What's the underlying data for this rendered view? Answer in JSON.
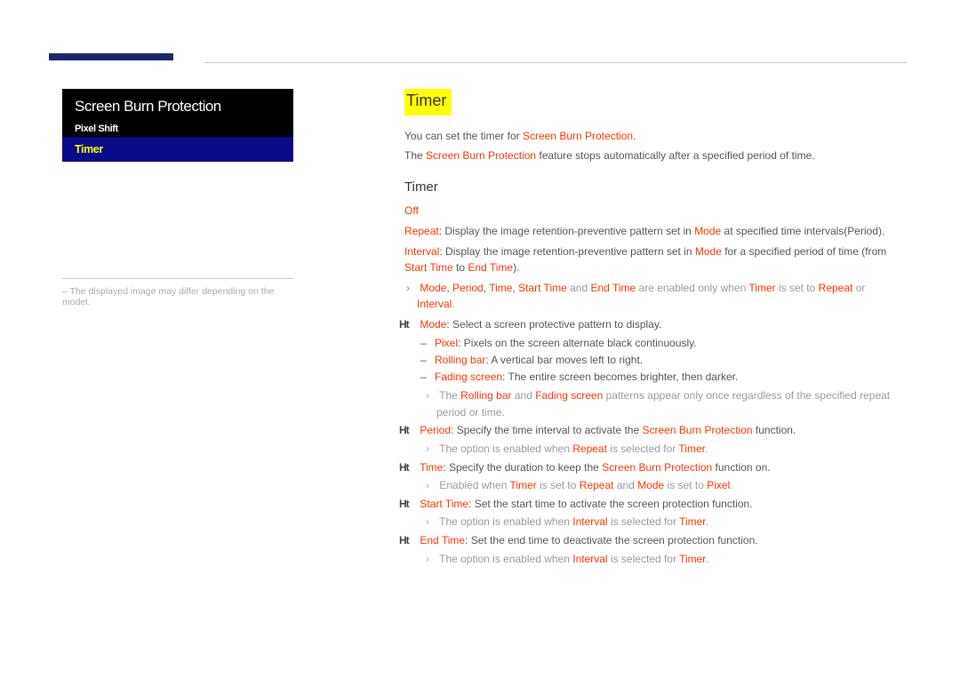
{
  "left": {
    "panel_title": "Screen Burn Protection",
    "row_pixel": "Pixel Shift",
    "row_timer": "Timer",
    "disclaimer": "The displayed image may differ depending on the model."
  },
  "right": {
    "section": "Timer",
    "intro1a": "You can set the timer for ",
    "intro1b": "Screen Burn Protection",
    "intro1c": ".",
    "intro2a": "The ",
    "intro2b": "Screen Burn Protection",
    "intro2c": " feature stops automatically after a specified period of time.",
    "sub": "Timer",
    "off": "Off",
    "repeat_lbl": "Repeat",
    "repeat_txt1": ": Display the image retention-preventive pattern set in ",
    "repeat_txt2": " at specified time intervals(Period).",
    "interval_lbl": "Interval",
    "interval_txt1": ": Display the image retention-preventive pattern set in ",
    "interval_txt2": " for a specified period of time (from ",
    "interval_txt3": " to ",
    "interval_txt4": ").",
    "mode_w": "Mode",
    "period_w": "Period",
    "time_w": "Time",
    "start_w": "Start Time",
    "end_w": "End Time",
    "enabled_txt1": " are enabled only when ",
    "enabled_txt2": " is set to ",
    "enabled_txt3": " or ",
    "enabled_txt4": ".",
    "and": " and ",
    "comma": ", ",
    "timer_w": "Timer",
    "repeat_w": "Repeat",
    "interval_w": "Interval",
    "mode_desc": ": Select a screen protective pattern to display.",
    "pixel_w": "Pixel",
    "pixel_desc": ": Pixels on the screen alternate black continuously.",
    "rolling_w": "Rolling bar",
    "rolling_desc": ": A vertical bar moves left to right.",
    "fading_w": "Fading screen",
    "fading_desc": ": The entire screen becomes brighter, then darker.",
    "rb_note1": "The ",
    "rb_note2": " and ",
    "rb_note3": " patterns appear only once regardless of the specified repeat period or time.",
    "period_desc1": ": Specify the time interval to activate the ",
    "sbp": "Screen Burn Protection",
    "period_desc2": " function.",
    "period_note1": "The option is enabled when ",
    "period_note2": " is selected for ",
    "time_desc1": ": Specify the duration to keep the ",
    "time_desc2": " function on.",
    "time_note1": "Enabled when ",
    "time_note2": " is set to ",
    "time_note3": " and ",
    "time_note4": " is set to ",
    "start_desc": ": Set the start time to activate the screen protection function.",
    "start_note1": "The option is enabled when ",
    "start_note2": " is selected for ",
    "end_desc": ": Set the end time to deactivate the screen protection function.",
    "dot": "."
  }
}
